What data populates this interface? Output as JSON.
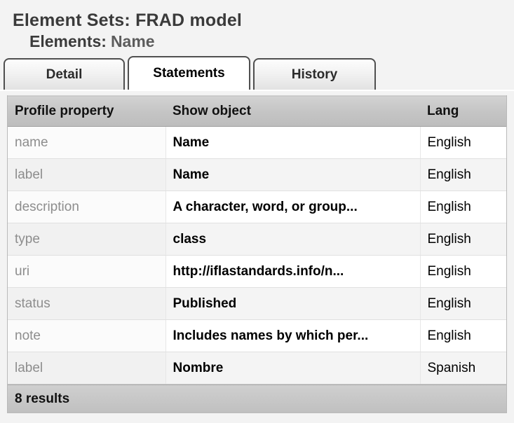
{
  "header": {
    "element_sets_label": "Element Sets: FRAD model",
    "elements_label": "Elements:",
    "elements_value": "Name"
  },
  "tabs": [
    {
      "label": "Detail",
      "active": false
    },
    {
      "label": "Statements",
      "active": true
    },
    {
      "label": "History",
      "active": false
    }
  ],
  "table": {
    "columns": [
      "Profile property",
      "Show object",
      "Lang"
    ],
    "rows": [
      {
        "property": "name",
        "object": "Name",
        "lang": "English"
      },
      {
        "property": "label",
        "object": "Name",
        "lang": "English"
      },
      {
        "property": "description",
        "object": "A character, word, or group...",
        "lang": "English"
      },
      {
        "property": "type",
        "object": "class",
        "lang": "English"
      },
      {
        "property": "uri",
        "object": "http://iflastandards.info/n...",
        "lang": "English"
      },
      {
        "property": "status",
        "object": "Published",
        "lang": "English"
      },
      {
        "property": "note",
        "object": "Includes names by which per...",
        "lang": "English"
      },
      {
        "property": "label",
        "object": "Nombre",
        "lang": "Spanish"
      }
    ]
  },
  "footer": {
    "results_text": "8 results"
  },
  "colors": {
    "page_background": "#f3f3f3",
    "header_band": "#c4c4c4",
    "active_tab": "#ffffff",
    "property_text": "#8d8d8d",
    "title_text": "#3a3a3a"
  }
}
